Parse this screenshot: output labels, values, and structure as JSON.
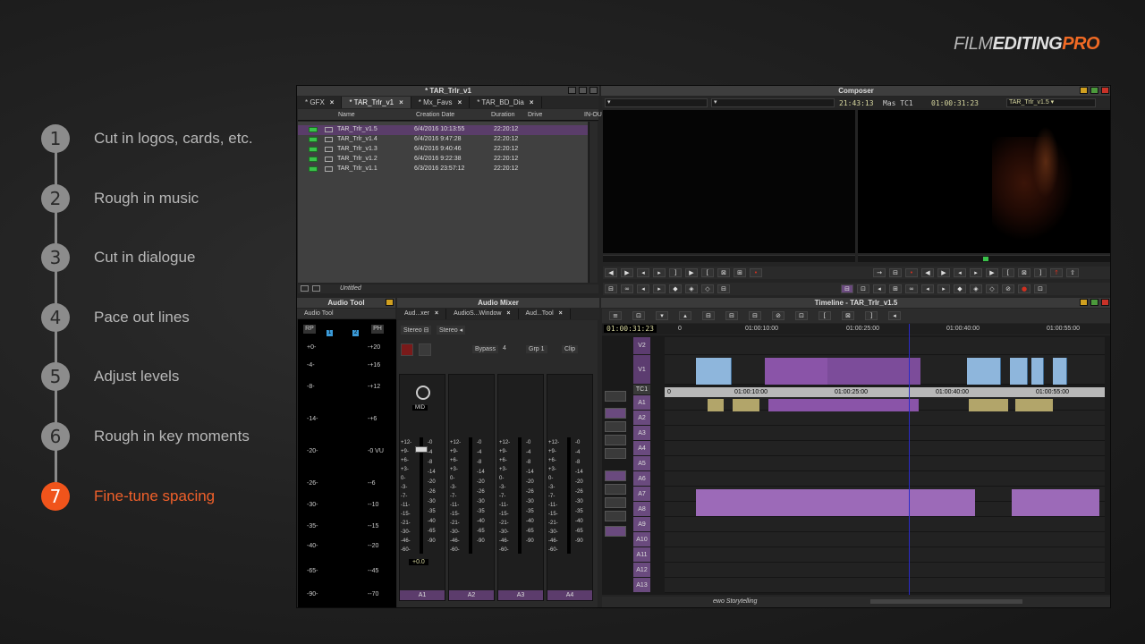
{
  "brand": {
    "part1": "FILM",
    "part2": "EDITING",
    "part3": "PRO",
    "accent": "#f0541b"
  },
  "steps": [
    {
      "num": "1",
      "label": "Cut in logos, cards, etc."
    },
    {
      "num": "2",
      "label": "Rough in music"
    },
    {
      "num": "3",
      "label": "Cut in dialogue"
    },
    {
      "num": "4",
      "label": "Pace out lines"
    },
    {
      "num": "5",
      "label": "Adjust levels"
    },
    {
      "num": "6",
      "label": "Rough in key moments"
    },
    {
      "num": "7",
      "label": "Fine-tune spacing"
    }
  ],
  "bin": {
    "title": "* TAR_Trlr_v1",
    "tabs": [
      {
        "label": "* GFX"
      },
      {
        "label": "* TAR_Trlr_v1"
      },
      {
        "label": "* Mx_Favs"
      },
      {
        "label": "* TAR_BD_Dia"
      }
    ],
    "columns": {
      "name": "Name",
      "created": "Creation Date",
      "duration": "Duration",
      "drive": "Drive",
      "in": "IN-OU"
    },
    "rows": [
      {
        "name": "TAR_Trlr_v1.5",
        "created": "6/4/2016 10:13:55",
        "duration": "22:20:12"
      },
      {
        "name": "TAR_Trlr_v1.4",
        "created": "6/4/2016 9:47:28",
        "duration": "22:20:12"
      },
      {
        "name": "TAR_Trlr_v1.3",
        "created": "6/4/2016 9:40:46",
        "duration": "22:20:12"
      },
      {
        "name": "TAR_Trlr_v1.2",
        "created": "6/4/2016 9:22:38",
        "duration": "22:20:12"
      },
      {
        "name": "TAR_Trlr_v1.1",
        "created": "6/3/2016 23:57:12",
        "duration": "22:20:12"
      }
    ],
    "footer_view": "Untitled"
  },
  "composer": {
    "title": "Composer",
    "tc1": "21:43:13",
    "tc_label": "Mas TC1",
    "tc2": "01:00:31:23",
    "sequence": "TAR_Trlr_v1.5"
  },
  "audio_tool": {
    "title": "Audio Tool",
    "tab": "Audio Tool",
    "btn_rp": "RP",
    "btn_ph": "PH",
    "ch1": "1",
    "ch2": "2",
    "left_scale": [
      "+0-",
      "-4-",
      "-8-",
      "-14-",
      "-20-",
      "-26-",
      "-30-",
      "-35-",
      "-40-",
      "-65-",
      "-90-"
    ],
    "right_scale": [
      "-+20",
      "-+16",
      "-+12",
      "-+6",
      "-0 VU",
      "--6",
      "--10",
      "--15",
      "--20",
      "--45",
      "--70"
    ]
  },
  "audio_mixer": {
    "title": "Audio Mixer",
    "tabs": [
      {
        "label": "Aud...xer"
      },
      {
        "label": "AudioS...Window"
      },
      {
        "label": "Aud...Tool"
      }
    ],
    "stereo1": "Stereo",
    "stereo2": "Stereo",
    "bypass": "Bypass",
    "bypass_num": "4",
    "grp": "Grp 1",
    "clip": "Clip",
    "mode": "MID",
    "gain": "+0.0",
    "scale_left": [
      "+12-",
      "+9-",
      "+6-",
      "+3-",
      "0-",
      "-3-",
      "-7-",
      "-11-",
      "-15-",
      "-21-",
      "-30-",
      "-46-",
      "-60-"
    ],
    "scale_right": [
      "-0",
      "-4",
      "-8",
      "-14",
      "-20",
      "-26",
      "-30",
      "-35",
      "-40",
      "-65",
      "-90"
    ],
    "strips": [
      {
        "label": "A1"
      },
      {
        "label": "A2"
      },
      {
        "label": "A3"
      },
      {
        "label": "A4"
      }
    ]
  },
  "timeline": {
    "title": "Timeline - TAR_Trlr_v1.5",
    "tc": "01:00:31:23",
    "ruler": [
      "0",
      "01:00:10:00",
      "01:00:25:00",
      "01:00:40:00",
      "01:00:55:00"
    ],
    "tc1_ruler": [
      "0",
      "01:00:10:00",
      "01:00:25:00",
      "01:00:40:00",
      "01:00:55:00"
    ],
    "tracks": [
      "V2",
      "V1",
      "TC1",
      "A1",
      "A2",
      "A3",
      "A4",
      "A5",
      "A6",
      "A7",
      "A8",
      "A9",
      "A10",
      "A11",
      "A12",
      "A13"
    ],
    "footer_label": "ewo Storytelling"
  }
}
